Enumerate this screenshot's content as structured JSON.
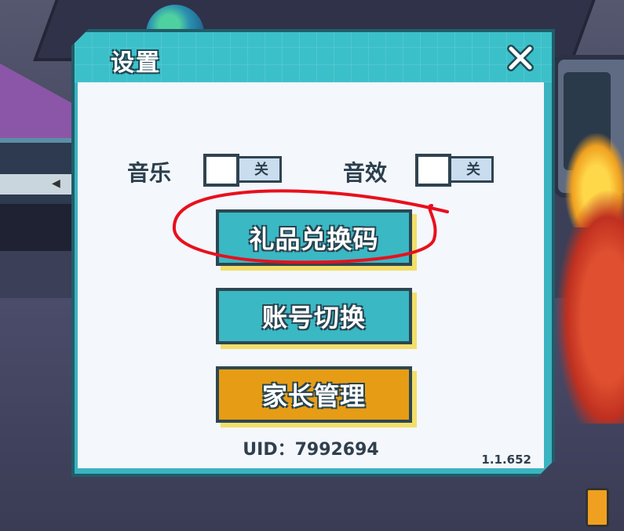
{
  "dialog": {
    "title": "设置",
    "close_icon": "close-icon",
    "settings": [
      {
        "label": "音乐",
        "toggle_state": "关",
        "on": false
      },
      {
        "label": "音效",
        "toggle_state": "关",
        "on": false
      }
    ],
    "buttons": [
      {
        "label": "礼品兑换码",
        "color": "#3ab8c4"
      },
      {
        "label": "账号切换",
        "color": "#3ab8c4"
      },
      {
        "label": "家长管理",
        "color": "#e69d15"
      }
    ],
    "uid": "UID：7992694",
    "version": "1.1.652"
  },
  "colors": {
    "accent_teal": "#3bb3c0",
    "annotation_red": "#e8101c",
    "button_shadow": "#f2de6a"
  }
}
